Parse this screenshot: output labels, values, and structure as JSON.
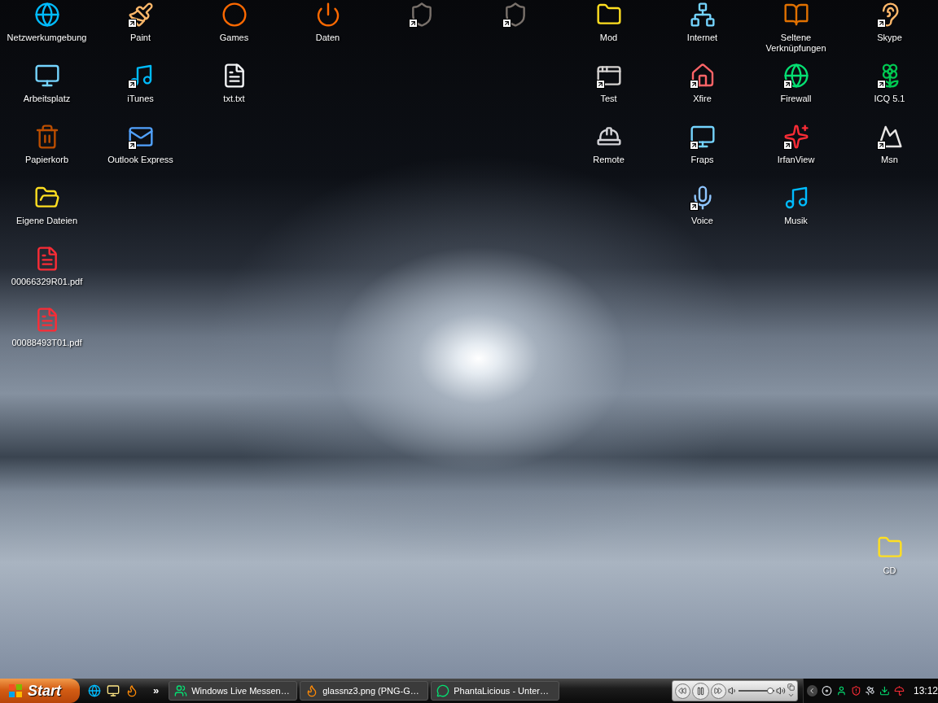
{
  "desktop": {
    "columns": [
      {
        "icons": [
          {
            "label": "Netzwerkumgebung",
            "kind": "network",
            "shortcut": false
          },
          {
            "label": "Arbeitsplatz",
            "kind": "computer",
            "shortcut": false
          },
          {
            "label": "Papierkorb",
            "kind": "trash",
            "shortcut": false
          },
          {
            "label": "Eigene Dateien",
            "kind": "documents",
            "shortcut": false
          },
          {
            "label": "00066329R01.pdf",
            "kind": "pdf",
            "shortcut": false
          },
          {
            "label": "00088493T01.pdf",
            "kind": "pdf",
            "shortcut": false
          }
        ]
      },
      {
        "icons": [
          {
            "label": "Paint",
            "kind": "paint",
            "shortcut": true
          },
          {
            "label": "iTunes",
            "kind": "music",
            "shortcut": true
          },
          {
            "label": "Outlook Express",
            "kind": "mail",
            "shortcut": true
          }
        ]
      },
      {
        "icons": [
          {
            "label": "Games",
            "kind": "ring",
            "shortcut": false
          },
          {
            "label": "txt.txt",
            "kind": "text",
            "shortcut": false
          }
        ]
      },
      {
        "icons": [
          {
            "label": "Daten",
            "kind": "power",
            "shortcut": false
          }
        ]
      },
      {
        "icons": [
          {
            "kind": "shield",
            "shortcut": true
          }
        ]
      },
      {
        "icons": [
          {
            "kind": "shield",
            "shortcut": true
          }
        ]
      },
      {
        "icons": [
          {
            "label": "Mod",
            "kind": "folder",
            "shortcut": false
          },
          {
            "label": "Test",
            "kind": "app",
            "shortcut": true
          },
          {
            "label": "Remote",
            "kind": "helmet",
            "shortcut": false
          }
        ]
      },
      {
        "icons": [
          {
            "label": "Internet",
            "kind": "network-folder",
            "shortcut": false
          },
          {
            "label": "Xfire",
            "kind": "house",
            "shortcut": true
          },
          {
            "label": "Fraps",
            "kind": "computer",
            "shortcut": true
          },
          {
            "label": "Voice",
            "kind": "mic",
            "shortcut": true
          }
        ]
      },
      {
        "icons": [
          {
            "label": "Seltene Verknüpfungen",
            "kind": "book",
            "shortcut": false
          },
          {
            "label": "Firewall",
            "kind": "globe",
            "shortcut": true
          },
          {
            "label": "IrfanView",
            "kind": "splat",
            "shortcut": true
          },
          {
            "label": "Musik",
            "kind": "music",
            "shortcut": false
          }
        ]
      },
      {
        "icons": [
          {
            "label": "Skype",
            "kind": "ear",
            "shortcut": true
          },
          {
            "label": "ICQ 5.1",
            "kind": "flower",
            "shortcut": true
          },
          {
            "label": "Msn",
            "kind": "mountain",
            "shortcut": true
          }
        ],
        "bottom_icons": [
          {
            "label": "CD",
            "kind": "folder",
            "shortcut": false
          }
        ]
      }
    ]
  },
  "taskbar": {
    "start": "Start",
    "quick_launch": [
      {
        "kind": "ie"
      },
      {
        "kind": "desktop"
      },
      {
        "kind": "firefox"
      }
    ],
    "overflow": "»",
    "tasks": [
      {
        "label": "Windows Live Messen…",
        "kind": "messenger",
        "selected": false
      },
      {
        "label": "glassnz3.png (PNG-G…",
        "kind": "firefox",
        "selected": false
      },
      {
        "label": "PhantaLicious - Unter…",
        "kind": "chat",
        "selected": false
      }
    ],
    "media_player": {
      "volume": {
        "level": 0.88
      }
    },
    "tray": {
      "icons": [
        {
          "kind": "disc"
        },
        {
          "kind": "user"
        },
        {
          "kind": "shield"
        },
        {
          "kind": "satellite"
        },
        {
          "kind": "download"
        },
        {
          "kind": "umbrella"
        }
      ],
      "clock": "13:12"
    }
  }
}
